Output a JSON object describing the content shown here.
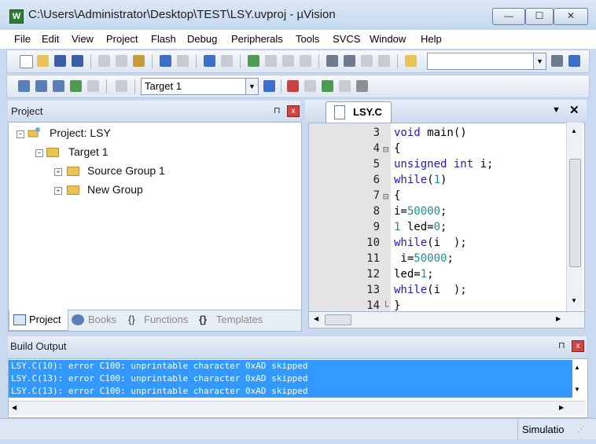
{
  "window": {
    "title": "C:\\Users\\Administrator\\Desktop\\TEST\\LSY.uvproj - µVision",
    "app_icon": "W",
    "minimize": "—",
    "maximize": "☐",
    "close": "✕"
  },
  "menu": [
    "File",
    "Edit",
    "View",
    "Project",
    "Flash",
    "Debug",
    "Peripherals",
    "Tools",
    "SVCS",
    "Window",
    "Help"
  ],
  "toolbar": {
    "find_combo_value": "",
    "target_combo_value": "Target 1"
  },
  "project_panel": {
    "title": "Project",
    "pin": "⊓",
    "close": "x",
    "tree": {
      "root": "Project: LSY",
      "target": "Target 1",
      "groups": [
        "Source Group 1",
        "New Group"
      ]
    },
    "tabs": [
      "Project",
      "Books",
      "Functions",
      "Templates"
    ]
  },
  "editor": {
    "tab": "LSY.C",
    "dropdown": "▼",
    "close": "✕",
    "lines": [
      {
        "n": "3",
        "code": "void main()"
      },
      {
        "n": "4",
        "code": "{"
      },
      {
        "n": "5",
        "code": "unsigned int i;"
      },
      {
        "n": "6",
        "code": "while(1)"
      },
      {
        "n": "7",
        "code": "{"
      },
      {
        "n": "8",
        "code": "i=50000;"
      },
      {
        "n": "9",
        "code": "1 led=0;"
      },
      {
        "n": "10",
        "code": "while(i  );"
      },
      {
        "n": "11",
        "code": " i=50000;"
      },
      {
        "n": "12",
        "code": "led=1;"
      },
      {
        "n": "13",
        "code": "while(i  );"
      },
      {
        "n": "14",
        "code": "}"
      }
    ]
  },
  "build_output": {
    "title": "Build Output",
    "messages": [
      "LSY.C(10): error C100: unprintable character 0xAD skipped",
      "LSY.C(13): error C100: unprintable character 0xAD skipped",
      "LSY.C(13): error C100: unprintable character 0xAD skipped"
    ]
  },
  "status": {
    "mode": "Simulatio"
  }
}
